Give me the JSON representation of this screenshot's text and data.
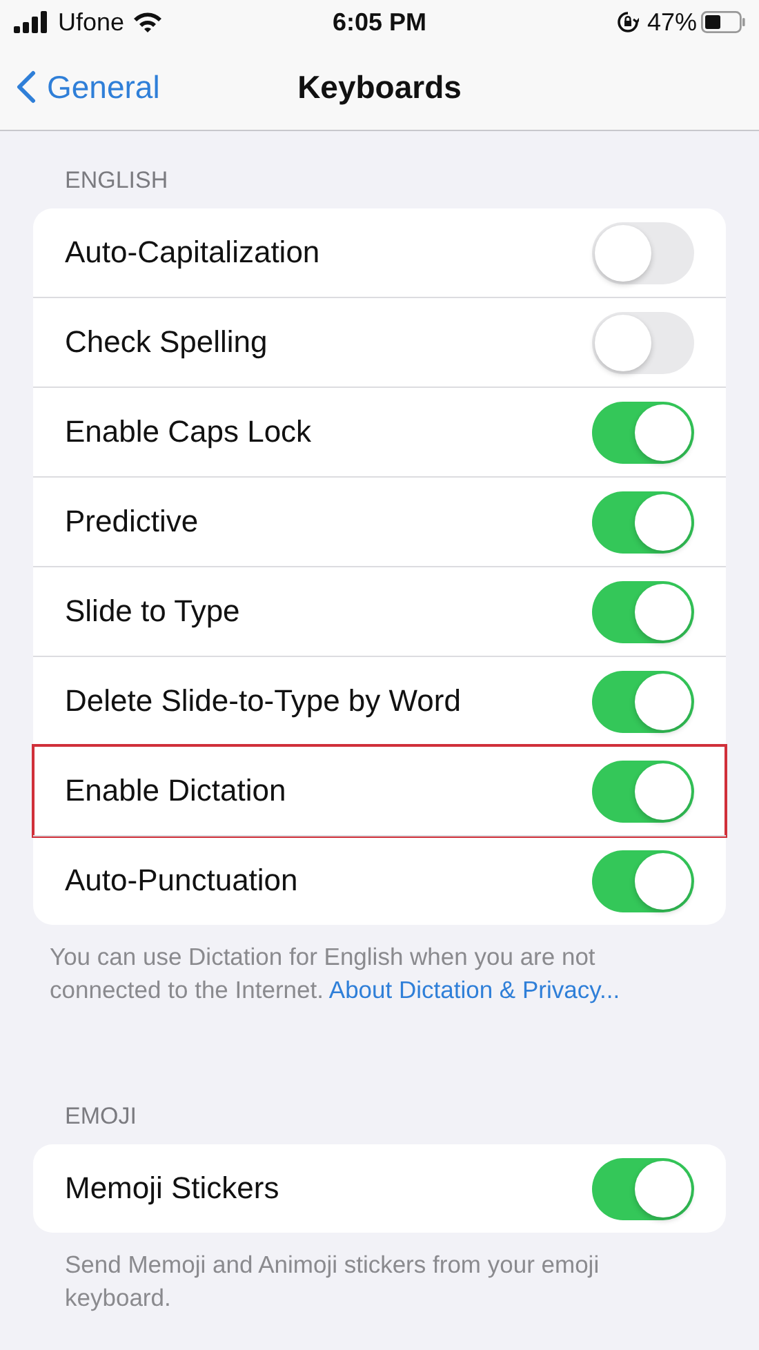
{
  "status_bar": {
    "carrier": "Ufone",
    "time": "6:05 PM",
    "battery": "47%"
  },
  "nav": {
    "back": "General",
    "title": "Keyboards"
  },
  "sections": [
    {
      "header": "ENGLISH",
      "rows": [
        {
          "label": "Auto-Capitalization",
          "on": false,
          "highlighted": false
        },
        {
          "label": "Check Spelling",
          "on": false,
          "highlighted": false
        },
        {
          "label": "Enable Caps Lock",
          "on": true,
          "highlighted": false
        },
        {
          "label": "Predictive",
          "on": true,
          "highlighted": false
        },
        {
          "label": "Slide to Type",
          "on": true,
          "highlighted": false
        },
        {
          "label": "Delete Slide-to-Type by Word",
          "on": true,
          "highlighted": false
        },
        {
          "label": "Enable Dictation",
          "on": true,
          "highlighted": true
        },
        {
          "label": "Auto-Punctuation",
          "on": true,
          "highlighted": false
        }
      ],
      "footer": {
        "text": "You can use Dictation for English when you are not connected to the Internet.",
        "link": "About Dictation & Privacy..."
      }
    },
    {
      "header": "EMOJI",
      "rows": [
        {
          "label": "Memoji Stickers",
          "on": true,
          "highlighted": false
        }
      ],
      "footer": {
        "text": "Send Memoji and Animoji stickers from your emoji keyboard."
      }
    }
  ]
}
